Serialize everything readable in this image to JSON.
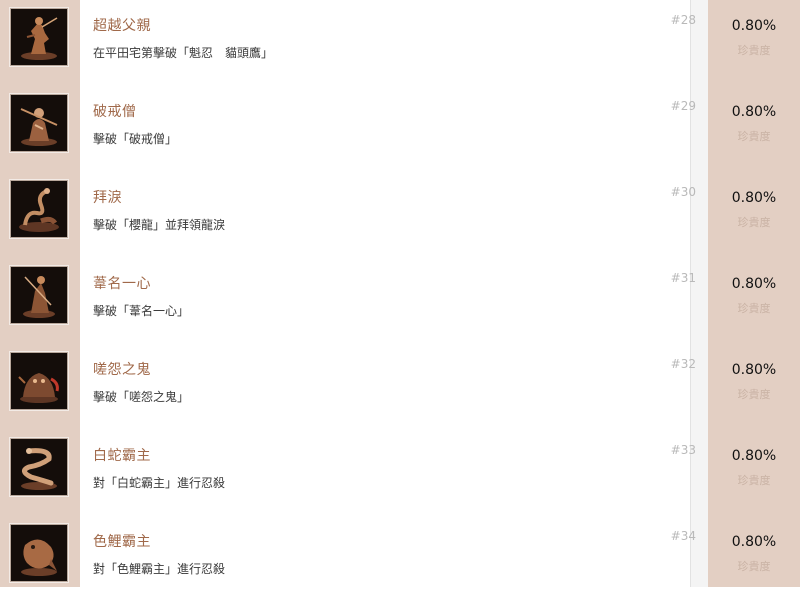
{
  "achievements": [
    {
      "title": "超越父親",
      "description": "在平田宅第擊破「魁忍　貓頭鷹」",
      "rank": "#28",
      "percent": "0.80%",
      "rarity_label": "珍貴度",
      "icon": "warrior-statue-icon"
    },
    {
      "title": "破戒僧",
      "description": "擊破「破戒僧」",
      "rank": "#29",
      "percent": "0.80%",
      "rarity_label": "珍貴度",
      "icon": "monk-statue-icon"
    },
    {
      "title": "拜淚",
      "description": "擊破「櫻龍」並拜領龍淚",
      "rank": "#30",
      "percent": "0.80%",
      "rarity_label": "珍貴度",
      "icon": "dragon-statue-icon"
    },
    {
      "title": "葦名一心",
      "description": "擊破「葦名一心」",
      "rank": "#31",
      "percent": "0.80%",
      "rarity_label": "珍貴度",
      "icon": "swordsman-statue-icon"
    },
    {
      "title": "嗟怨之鬼",
      "description": "擊破「嗟怨之鬼」",
      "rank": "#32",
      "percent": "0.80%",
      "rarity_label": "珍貴度",
      "icon": "demon-statue-icon"
    },
    {
      "title": "白蛇霸主",
      "description": "對「白蛇霸主」進行忍殺",
      "rank": "#33",
      "percent": "0.80%",
      "rarity_label": "珍貴度",
      "icon": "serpent-statue-icon"
    },
    {
      "title": "色鯉霸主",
      "description": "對「色鯉霸主」進行忍殺",
      "rank": "#34",
      "percent": "0.80%",
      "rarity_label": "珍貴度",
      "icon": "carp-statue-icon"
    }
  ]
}
